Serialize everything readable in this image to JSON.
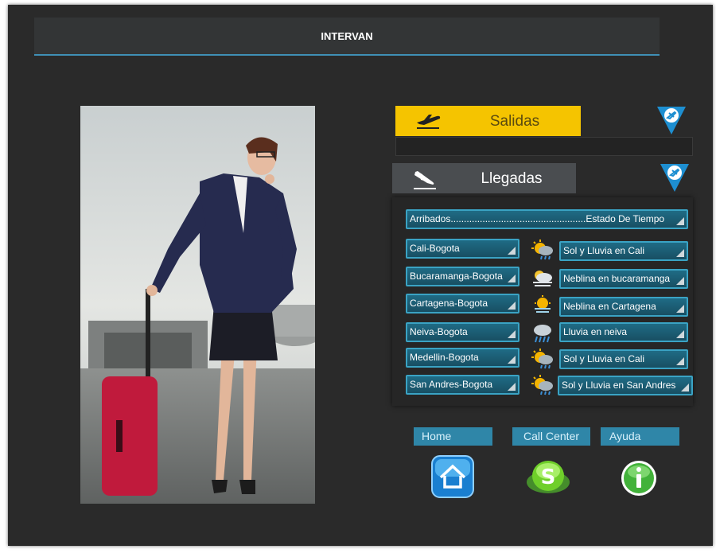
{
  "header": {
    "title": "INTERVAN"
  },
  "salidas": {
    "label": "Salidas",
    "icon": "plane-takeoff-icon"
  },
  "llegadas": {
    "label": "Llegadas",
    "icon": "plane-landing-icon"
  },
  "table": {
    "header": "Arribados...................................................Estado De Tiempo",
    "rows": [
      {
        "route": "Cali-Bogota",
        "weather_icon": "sun-rain-icon",
        "weather": "Sol y Lluvia en Cali"
      },
      {
        "route": "Bucaramanga-Bogota",
        "weather_icon": "fog-icon",
        "weather": "Neblina en bucaramanga"
      },
      {
        "route": "Cartagena-Bogota",
        "weather_icon": "sun-haze-icon",
        "weather": "Neblina en Cartagena"
      },
      {
        "route": "Neiva-Bogota",
        "weather_icon": "rain-icon",
        "weather": "Lluvia en neiva"
      },
      {
        "route": "Medellin-Bogota",
        "weather_icon": "sun-rain-icon",
        "weather": "Sol y Lluvia en Cali"
      },
      {
        "route": "San Andres-Bogota",
        "weather_icon": "sun-rain-icon",
        "weather": "Sol y Lluvia en San Andres"
      }
    ]
  },
  "nav": {
    "home": "Home",
    "call_center": "Call Center",
    "help": "Ayuda"
  },
  "colors": {
    "accent": "#2f86a8",
    "salidas": "#f5c400",
    "panel": "#262626"
  }
}
